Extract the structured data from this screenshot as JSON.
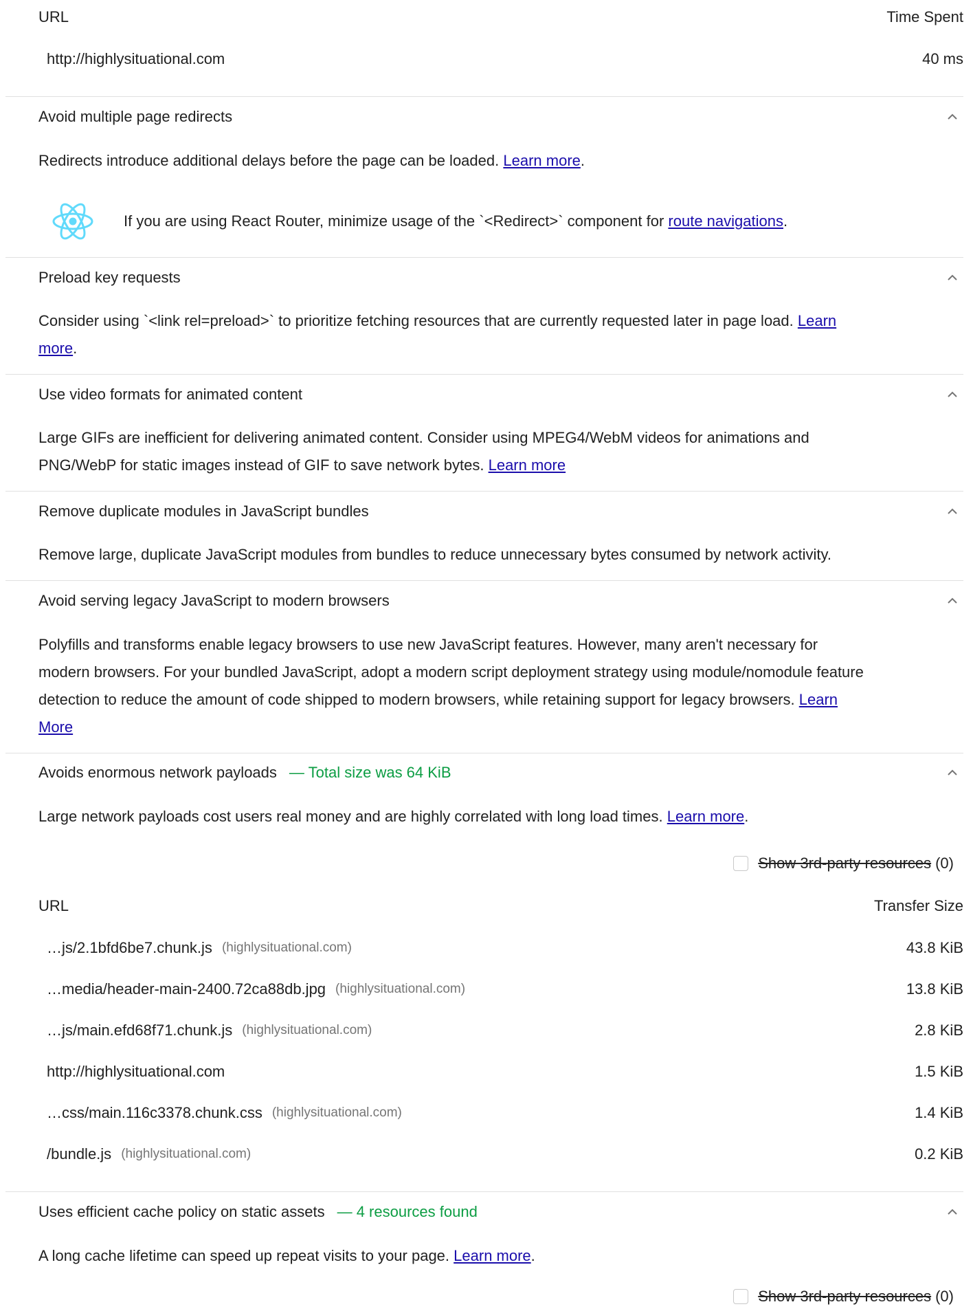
{
  "top_table": {
    "col_url": "URL",
    "col_value": "Time Spent",
    "rows": [
      {
        "url": "http://highlysituational.com",
        "value": "40 ms"
      }
    ]
  },
  "audits": [
    {
      "title": "Avoid multiple page redirects",
      "desc": "Redirects introduce additional delays before the page can be loaded.",
      "link": "Learn more",
      "tail": ".",
      "hint": {
        "icon": "react-icon",
        "text": "If you are using React Router, minimize usage of the `<Redirect>` component for",
        "link": "route navigations",
        "tail": "."
      }
    },
    {
      "title": "Preload key requests",
      "desc_line1": "Consider using `<link rel=preload>` to prioritize fetching resources that are currently requested later in page load.",
      "link_line1": "Learn",
      "link_line2": "more",
      "tail": "."
    },
    {
      "title": "Use video formats for animated content",
      "desc_line1": "Large GIFs are inefficient for delivering animated content. Consider using MPEG4/WebM videos for animations and",
      "desc_line2": "PNG/WebP for static images instead of GIF to save network bytes.",
      "link": "Learn more"
    },
    {
      "title": "Remove duplicate modules in JavaScript bundles",
      "desc": "Remove large, duplicate JavaScript modules from bundles to reduce unnecessary bytes consumed by network activity."
    },
    {
      "title": "Avoid serving legacy JavaScript to modern browsers",
      "desc_line1": "Polyfills and transforms enable legacy browsers to use new JavaScript features. However, many aren't necessary for",
      "desc_line2": "modern browsers. For your bundled JavaScript, adopt a modern script deployment strategy using module/nomodule feature",
      "desc_line3": "detection to reduce the amount of code shipped to modern browsers, while retaining support for legacy browsers.",
      "link_line3": "Learn",
      "link_line4": "More"
    },
    {
      "title": "Avoids enormous network payloads",
      "display_value": "— Total size was 64 KiB",
      "desc": "Large network payloads cost users real money and are highly correlated with long load times.",
      "link": "Learn more",
      "tail": ".",
      "filter": {
        "label": "Show 3rd-party resources",
        "count": "(0)"
      },
      "table": {
        "col_url": "URL",
        "col_value": "Transfer Size",
        "rows": [
          {
            "url": "…js/2.1bfd6be7.chunk.js",
            "host": "(highlysituational.com)",
            "value": "43.8 KiB"
          },
          {
            "url": "…media/header-main-2400.72ca88db.jpg",
            "host": "(highlysituational.com)",
            "value": "13.8 KiB"
          },
          {
            "url": "…js/main.efd68f71.chunk.js",
            "host": "(highlysituational.com)",
            "value": "2.8 KiB"
          },
          {
            "url": "http://highlysituational.com",
            "host": "",
            "value": "1.5 KiB"
          },
          {
            "url": "…css/main.116c3378.chunk.css",
            "host": "(highlysituational.com)",
            "value": "1.4 KiB"
          },
          {
            "url": "/bundle.js",
            "host": "(highlysituational.com)",
            "value": "0.2 KiB"
          }
        ]
      }
    },
    {
      "title": "Uses efficient cache policy on static assets",
      "display_value": "— 4 resources found",
      "desc": "A long cache lifetime can speed up repeat visits to your page.",
      "link": "Learn more",
      "tail": ".",
      "filter": {
        "label": "Show 3rd-party resources",
        "count": "(0)"
      }
    }
  ],
  "colors": {
    "pass": "#0c9d43",
    "link": "#1a0dab",
    "divider": "#e0e0e0",
    "react": "#61dafb"
  }
}
